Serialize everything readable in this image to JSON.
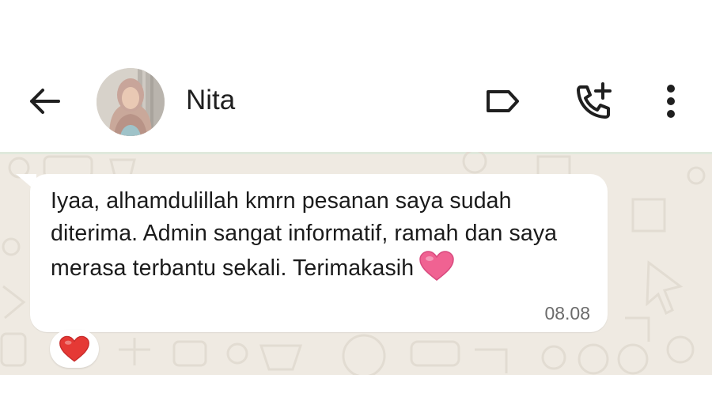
{
  "header": {
    "contact_name": "Nita",
    "back_icon": "arrow-left-icon",
    "label_icon": "label-icon",
    "call_icon": "add-call-icon",
    "menu_icon": "more-vertical-icon"
  },
  "message": {
    "text": "Iyaa, alhamdulillah kmrn pesanan saya sudah diterima. Admin sangat informatif, ramah dan saya merasa terbantu sekali. Terimakasih",
    "emoji": "pink-heart-emoji",
    "time": "08.08",
    "reaction": "red-heart-emoji"
  },
  "colors": {
    "chat_background": "#efeae2",
    "bubble": "#ffffff",
    "heart_pink": "#f06292",
    "heart_red": "#e53935"
  }
}
